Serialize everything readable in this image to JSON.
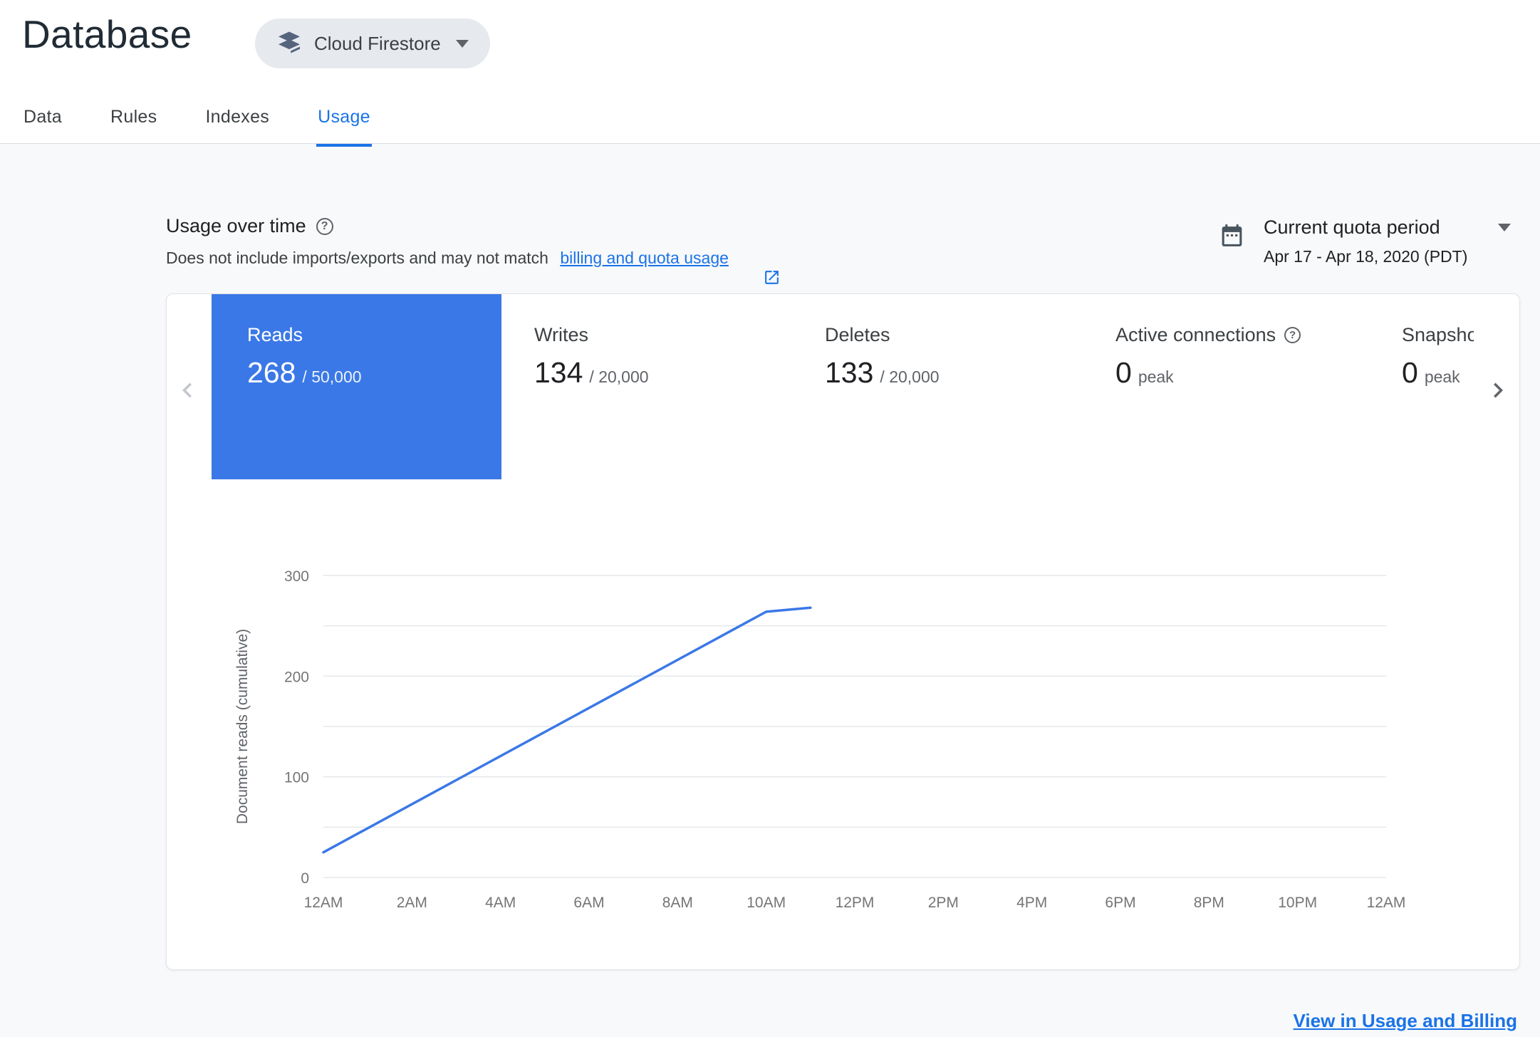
{
  "colors": {
    "accent": "#1a73e8",
    "selected_tile": "#3b78e7",
    "chart_line": "#3b78e7"
  },
  "header": {
    "title": "Database",
    "product_selector_label": "Cloud Firestore"
  },
  "tabs": [
    {
      "label": "Data",
      "active": false
    },
    {
      "label": "Rules",
      "active": false
    },
    {
      "label": "Indexes",
      "active": false
    },
    {
      "label": "Usage",
      "active": true
    }
  ],
  "usage_header": {
    "heading": "Usage over time",
    "description_prefix": "Does not include imports/exports and may not match ",
    "description_link_label": "billing and quota usage",
    "quota_period_label": "Current quota period",
    "quota_period_range": "Apr 17 - Apr 18, 2020 (PDT)"
  },
  "metrics": [
    {
      "label": "Reads",
      "value": "268",
      "suffix": "/ 50,000",
      "selected": true
    },
    {
      "label": "Writes",
      "value": "134",
      "suffix": "/ 20,000",
      "selected": false
    },
    {
      "label": "Deletes",
      "value": "133",
      "suffix": "/ 20,000",
      "selected": false
    },
    {
      "label": "Active connections",
      "value": "0",
      "suffix": "peak",
      "selected": false,
      "has_help": true
    },
    {
      "label": "Snapshots",
      "value": "0",
      "suffix": "peak",
      "selected": false
    }
  ],
  "chart_data": {
    "type": "line",
    "title": "",
    "ylabel": "Document reads (cumulative)",
    "x_ticks": [
      "12AM",
      "2AM",
      "4AM",
      "6AM",
      "8AM",
      "10AM",
      "12PM",
      "2PM",
      "4PM",
      "6PM",
      "8PM",
      "10PM",
      "12AM"
    ],
    "x_range_hours": [
      0,
      24
    ],
    "ylim": [
      0,
      300
    ],
    "y_tick_labels": [
      0,
      100,
      200,
      300
    ],
    "grid_step": 50,
    "grid": true,
    "legend": "none",
    "series": [
      {
        "name": "Document reads (cumulative)",
        "color": "#3b78e7",
        "points_hour_value": [
          [
            0,
            25
          ],
          [
            10,
            264
          ],
          [
            11,
            268
          ]
        ]
      }
    ]
  },
  "footer": {
    "link_label": "View in Usage and Billing"
  }
}
